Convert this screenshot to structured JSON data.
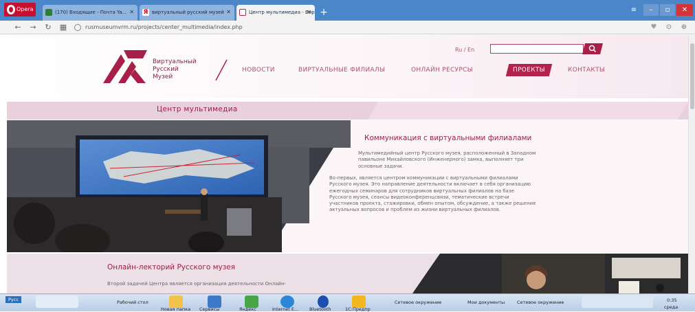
{
  "browser": {
    "opera_label": "Opera",
    "tabs": [
      {
        "label": "(170) Входящие - Почта Ya...",
        "icon": "mail-tab-icon"
      },
      {
        "label": "виртуальный русский музей",
        "icon": "yandex-tab-icon"
      },
      {
        "label": "Центр мультимедиа - Виртуальный",
        "icon": "museum-tab-icon"
      }
    ],
    "tab_close": "✕",
    "new_tab": "+",
    "url": "rusmuseumvrm.ru/projects/center_multimedia/index.php"
  },
  "site": {
    "logo": {
      "line1": "Виртуальный",
      "line2": "Русский",
      "line3": "Музей"
    },
    "menu": [
      "НОВОСТИ",
      "ВИРТУАЛЬНЫЕ ФИЛИАЛЫ",
      "ОНЛАЙН РЕСУРСЫ",
      "ПРОЕКТЫ",
      "КОНТАКТЫ"
    ],
    "active_menu": "ПРОЕКТЫ",
    "lang": "Ru / En",
    "search_placeholder": ""
  },
  "section_title": "Центр мультимедиа",
  "feature1": {
    "title": "Коммуникация с виртуальными филиалами",
    "p1_lines": [
      "Мультимедийный центр Русского музея, расположенный в Западном",
      "павильоне Михайловского (Инженерного) замка, выполняет три",
      "основные задачи."
    ],
    "p2_lines": [
      "Во-первых, является центром коммуникации с виртуальными филиалами",
      "Русского музея. Это направление деятельности включает в себя организацию",
      "ежегодных семинаров для сотрудников виртуальных филиалов на базе",
      "Русского музея, сеансы видеоконференцсвязи, тематические встречи",
      "участников проекта, стажировки, обмен опытом, обсуждение, а также решение",
      "актуальных вопросов и проблем из жизни виртуальных филиалов."
    ]
  },
  "feature2": {
    "title": "Онлайн-лекторий Русского музея",
    "text": "Второй задачей Центра является организация деятельности Онлайн-"
  },
  "taskbar": {
    "lang": "Русс",
    "desktop": "Рабочий стол",
    "items": [
      "Новая папка",
      "Сервисы",
      "Яндекс",
      "Internet E...",
      "Bluetooth",
      "1С:Предпр"
    ],
    "windows": [
      "Сетевое окружение",
      "Мои документы",
      "Сетевое окружение"
    ],
    "clock": "0:35",
    "day": "среда"
  },
  "colors": {
    "accent": "#a8204a",
    "band": "#e9d0dd",
    "chrome": "#4a86c8"
  }
}
